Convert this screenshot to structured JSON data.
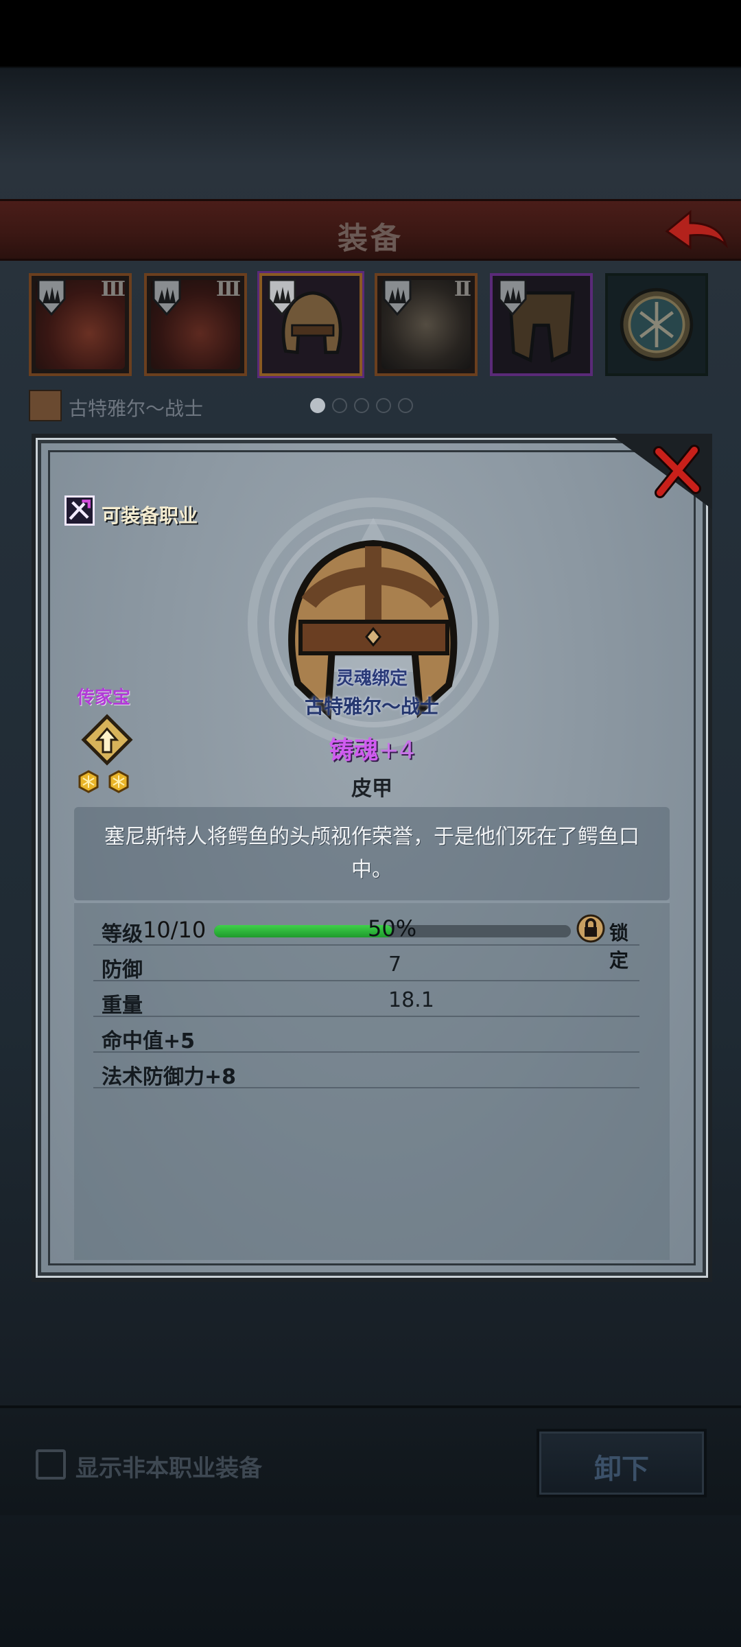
{
  "header": {
    "title": "装备",
    "back_icon": "back-arrow-icon",
    "accent": "#c0281f"
  },
  "slots": [
    {
      "tier": "III",
      "icon": "armor-feather-icon"
    },
    {
      "tier": "III",
      "icon": "armor-feather-icon"
    },
    {
      "tier": "",
      "icon": "helmet-icon",
      "selected": true
    },
    {
      "tier": "II",
      "icon": "fur-armor-icon"
    },
    {
      "tier": "",
      "icon": "boots-icon"
    },
    {
      "tier": "",
      "icon": "rune-amulet-icon"
    }
  ],
  "hero": {
    "name": "古特雅尔～战士",
    "page_dots_total": 5,
    "page_dots_active": 0
  },
  "detail": {
    "class_label": "可装备职业",
    "soul_bound": "灵魂绑定",
    "soul_bound_hero": "古特雅尔～战士",
    "forge_prefix": "铸魂",
    "forge_level": "+4",
    "item_type": "皮甲",
    "heirloom_label": "传家宝",
    "description": "塞尼斯特人将鳄鱼的头颅视作荣誉，于是他们死在了鳄鱼口中。",
    "level_label": "等级",
    "level_value": "10/10",
    "xp_percent": 50,
    "xp_percent_text": "50%",
    "lock_label": "锁定",
    "stats": [
      {
        "label": "防御",
        "value": "7"
      },
      {
        "label": "重量",
        "value": "18.1"
      },
      {
        "label": "命中值+5",
        "value": ""
      },
      {
        "label": "法术防御力+8",
        "value": ""
      }
    ],
    "colors": {
      "forge": "#d05cf0",
      "heirloom": "#b23ad8",
      "xp_bar": "#2fbf3c"
    }
  },
  "footer": {
    "checkbox_label": "显示非本职业装备",
    "checkbox_checked": false,
    "unequip_label": "卸下"
  }
}
